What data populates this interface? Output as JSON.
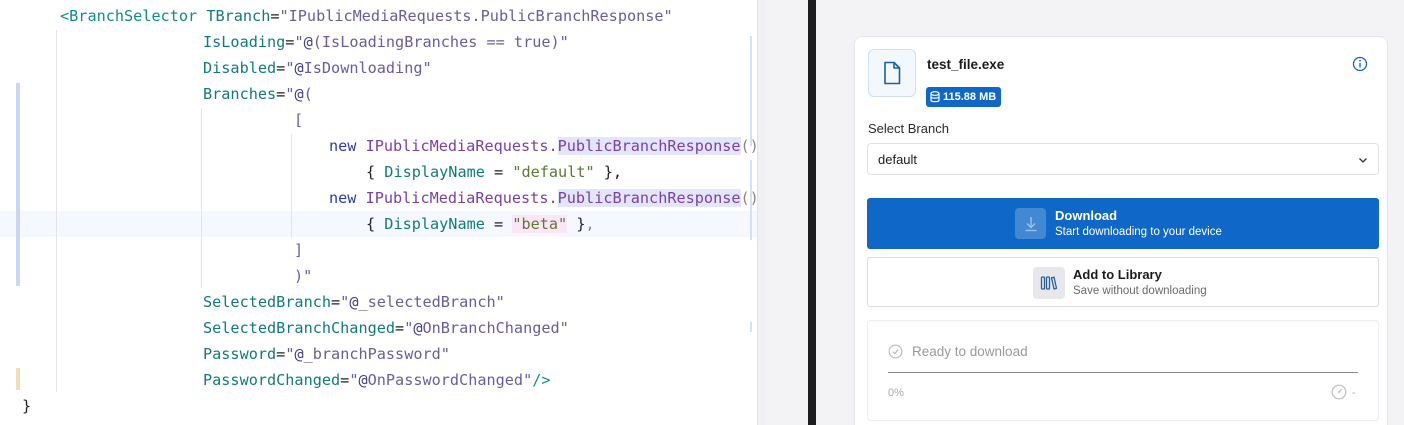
{
  "code": {
    "l1": {
      "open": "<",
      "tag": "BranchSelector",
      "attr": "TBranch",
      "eq": "=",
      "val": "\"IPublicMediaRequests.PublicBranchResponse\""
    },
    "l2": {
      "attr": "IsLoading",
      "eq": "=",
      "q": "\"",
      "at": "@",
      "expr": "(IsLoadingBranches == true)",
      "q2": "\""
    },
    "l3": {
      "attr": "Disabled",
      "eq": "=",
      "q": "\"",
      "at": "@",
      "expr": "IsDownloading",
      "q2": "\""
    },
    "l4": {
      "attr": "Branches",
      "eq": "=",
      "q": "\"",
      "at": "@",
      "expr": "("
    },
    "l5": {
      "text": "["
    },
    "l6": {
      "kw": "new",
      "ns": "IPublicMediaRequests.",
      "type": "PublicBranchResponse",
      "parens": "()"
    },
    "l7": {
      "open": "{ ",
      "prop": "DisplayName",
      "eq": " = ",
      "str": "\"default\"",
      "close": " }",
      "comma": ","
    },
    "l8": {
      "kw": "new",
      "ns": "IPublicMediaRequests.",
      "type": "PublicBranchResponse",
      "parens": "()"
    },
    "l9": {
      "open": "{ ",
      "prop": "DisplayName",
      "eq": " = ",
      "str": "\"beta\"",
      "close": " }",
      "comma": ","
    },
    "l10": {
      "text": "]"
    },
    "l11": {
      "text": ")\""
    },
    "l12": {
      "attr": "SelectedBranch",
      "eq": "=",
      "q": "\"",
      "at": "@",
      "expr": "_selectedBranch",
      "q2": "\""
    },
    "l13": {
      "attr": "SelectedBranchChanged",
      "eq": "=",
      "q": "\"",
      "at": "@",
      "expr": "OnBranchChanged",
      "q2": "\""
    },
    "l14": {
      "attr": "Password",
      "eq": "=",
      "q": "\"",
      "at": "@",
      "expr": "_branchPassword",
      "q2": "\""
    },
    "l15": {
      "attr": "PasswordChanged",
      "eq": "=",
      "q": "\"",
      "at": "@",
      "expr": "OnPasswordChanged",
      "q2": "\"",
      "close": "/>"
    },
    "l16": {
      "text": "}"
    }
  },
  "preview": {
    "file_name": "test_file.exe",
    "file_size": "115.88 MB",
    "branch_label": "Select Branch",
    "branch_value": "default",
    "download": {
      "title": "Download",
      "subtitle": "Start downloading to your device"
    },
    "library": {
      "title": "Add to Library",
      "subtitle": "Save without downloading"
    },
    "status": {
      "text": "Ready to download",
      "percent_label": "0%",
      "progress": 0,
      "speed": "-"
    }
  },
  "colors": {
    "accent": "#0f67c7",
    "tag": "#0d8d8e",
    "attribute": "#117c7c",
    "string": "#6c5c9e",
    "keyword": "#2b3bb8"
  },
  "icons": {
    "file": "file-icon",
    "size": "database-icon",
    "info": "info-icon",
    "dropdown": "chevron-down-icon",
    "download": "download-arrow-icon",
    "library": "library-books-icon",
    "status": "check-circle-icon",
    "speed": "speedometer-icon"
  }
}
